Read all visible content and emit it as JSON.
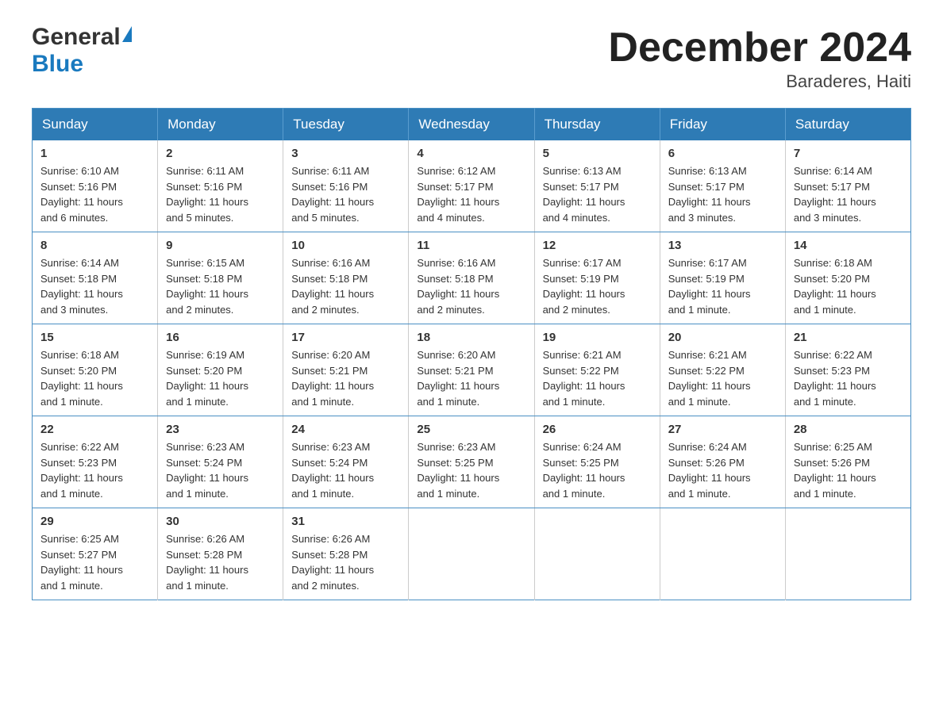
{
  "header": {
    "logo_general": "General",
    "logo_blue": "Blue",
    "month_title": "December 2024",
    "location": "Baraderes, Haiti"
  },
  "days_of_week": [
    "Sunday",
    "Monday",
    "Tuesday",
    "Wednesday",
    "Thursday",
    "Friday",
    "Saturday"
  ],
  "weeks": [
    [
      {
        "day": "1",
        "sunrise": "6:10 AM",
        "sunset": "5:16 PM",
        "daylight": "11 hours and 6 minutes."
      },
      {
        "day": "2",
        "sunrise": "6:11 AM",
        "sunset": "5:16 PM",
        "daylight": "11 hours and 5 minutes."
      },
      {
        "day": "3",
        "sunrise": "6:11 AM",
        "sunset": "5:16 PM",
        "daylight": "11 hours and 5 minutes."
      },
      {
        "day": "4",
        "sunrise": "6:12 AM",
        "sunset": "5:17 PM",
        "daylight": "11 hours and 4 minutes."
      },
      {
        "day": "5",
        "sunrise": "6:13 AM",
        "sunset": "5:17 PM",
        "daylight": "11 hours and 4 minutes."
      },
      {
        "day": "6",
        "sunrise": "6:13 AM",
        "sunset": "5:17 PM",
        "daylight": "11 hours and 3 minutes."
      },
      {
        "day": "7",
        "sunrise": "6:14 AM",
        "sunset": "5:17 PM",
        "daylight": "11 hours and 3 minutes."
      }
    ],
    [
      {
        "day": "8",
        "sunrise": "6:14 AM",
        "sunset": "5:18 PM",
        "daylight": "11 hours and 3 minutes."
      },
      {
        "day": "9",
        "sunrise": "6:15 AM",
        "sunset": "5:18 PM",
        "daylight": "11 hours and 2 minutes."
      },
      {
        "day": "10",
        "sunrise": "6:16 AM",
        "sunset": "5:18 PM",
        "daylight": "11 hours and 2 minutes."
      },
      {
        "day": "11",
        "sunrise": "6:16 AM",
        "sunset": "5:18 PM",
        "daylight": "11 hours and 2 minutes."
      },
      {
        "day": "12",
        "sunrise": "6:17 AM",
        "sunset": "5:19 PM",
        "daylight": "11 hours and 2 minutes."
      },
      {
        "day": "13",
        "sunrise": "6:17 AM",
        "sunset": "5:19 PM",
        "daylight": "11 hours and 1 minute."
      },
      {
        "day": "14",
        "sunrise": "6:18 AM",
        "sunset": "5:20 PM",
        "daylight": "11 hours and 1 minute."
      }
    ],
    [
      {
        "day": "15",
        "sunrise": "6:18 AM",
        "sunset": "5:20 PM",
        "daylight": "11 hours and 1 minute."
      },
      {
        "day": "16",
        "sunrise": "6:19 AM",
        "sunset": "5:20 PM",
        "daylight": "11 hours and 1 minute."
      },
      {
        "day": "17",
        "sunrise": "6:20 AM",
        "sunset": "5:21 PM",
        "daylight": "11 hours and 1 minute."
      },
      {
        "day": "18",
        "sunrise": "6:20 AM",
        "sunset": "5:21 PM",
        "daylight": "11 hours and 1 minute."
      },
      {
        "day": "19",
        "sunrise": "6:21 AM",
        "sunset": "5:22 PM",
        "daylight": "11 hours and 1 minute."
      },
      {
        "day": "20",
        "sunrise": "6:21 AM",
        "sunset": "5:22 PM",
        "daylight": "11 hours and 1 minute."
      },
      {
        "day": "21",
        "sunrise": "6:22 AM",
        "sunset": "5:23 PM",
        "daylight": "11 hours and 1 minute."
      }
    ],
    [
      {
        "day": "22",
        "sunrise": "6:22 AM",
        "sunset": "5:23 PM",
        "daylight": "11 hours and 1 minute."
      },
      {
        "day": "23",
        "sunrise": "6:23 AM",
        "sunset": "5:24 PM",
        "daylight": "11 hours and 1 minute."
      },
      {
        "day": "24",
        "sunrise": "6:23 AM",
        "sunset": "5:24 PM",
        "daylight": "11 hours and 1 minute."
      },
      {
        "day": "25",
        "sunrise": "6:23 AM",
        "sunset": "5:25 PM",
        "daylight": "11 hours and 1 minute."
      },
      {
        "day": "26",
        "sunrise": "6:24 AM",
        "sunset": "5:25 PM",
        "daylight": "11 hours and 1 minute."
      },
      {
        "day": "27",
        "sunrise": "6:24 AM",
        "sunset": "5:26 PM",
        "daylight": "11 hours and 1 minute."
      },
      {
        "day": "28",
        "sunrise": "6:25 AM",
        "sunset": "5:26 PM",
        "daylight": "11 hours and 1 minute."
      }
    ],
    [
      {
        "day": "29",
        "sunrise": "6:25 AM",
        "sunset": "5:27 PM",
        "daylight": "11 hours and 1 minute."
      },
      {
        "day": "30",
        "sunrise": "6:26 AM",
        "sunset": "5:28 PM",
        "daylight": "11 hours and 1 minute."
      },
      {
        "day": "31",
        "sunrise": "6:26 AM",
        "sunset": "5:28 PM",
        "daylight": "11 hours and 2 minutes."
      },
      null,
      null,
      null,
      null
    ]
  ],
  "labels": {
    "sunrise": "Sunrise:",
    "sunset": "Sunset:",
    "daylight": "Daylight:"
  }
}
